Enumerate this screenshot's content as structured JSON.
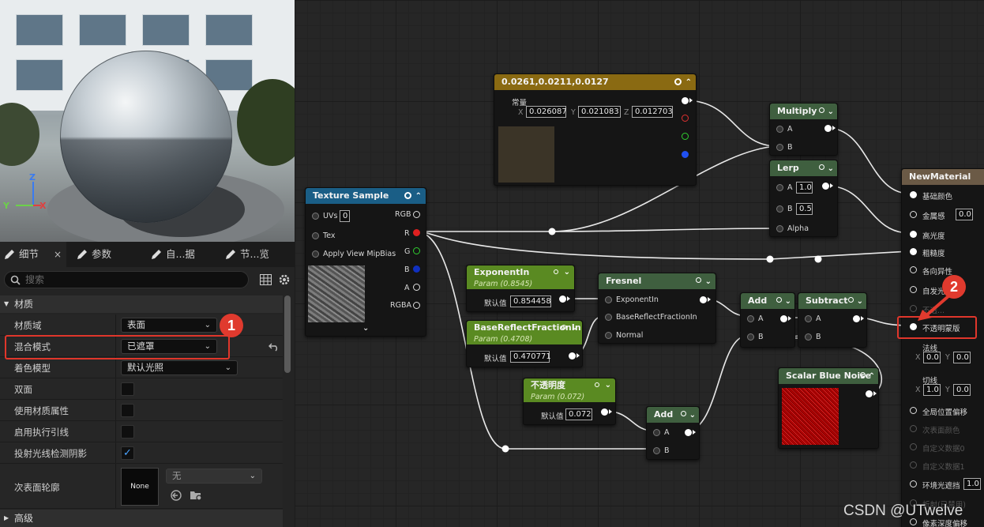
{
  "viewport": {
    "axis": {
      "z": "Z",
      "y": "Y",
      "x": "X"
    }
  },
  "tabs": [
    {
      "label": "细节",
      "close": "×"
    },
    {
      "label": "参数"
    },
    {
      "label": "自...据"
    },
    {
      "label": "节...览"
    }
  ],
  "search": {
    "placeholder": "搜索"
  },
  "details": {
    "section": "材质",
    "footer_section": "高级",
    "rows": {
      "domain": {
        "label": "材质域",
        "value": "表面"
      },
      "blend": {
        "label": "混合模式",
        "value": "已遮罩"
      },
      "shading": {
        "label": "着色模型",
        "value": "默认光照"
      },
      "two_sided": {
        "label": "双面"
      },
      "use_attr": {
        "label": "使用材质属性"
      },
      "exec_wires": {
        "label": "启用执行引线"
      },
      "rt_shadow": {
        "label": "投射光线检测阴影",
        "checked": "✓"
      },
      "subsurface": {
        "label": "次表面轮廓",
        "thumb": "None",
        "value": "无"
      }
    }
  },
  "nodes": {
    "constant": {
      "title": "0.0261,0.0211,0.0127",
      "label": "常量",
      "x_lbl": "X",
      "x": "0.026087",
      "y_lbl": "Y",
      "y": "0.021083",
      "z_lbl": "Z",
      "z": "0.012703"
    },
    "texture": {
      "title": "Texture Sample",
      "uvs": "UVs",
      "uvs_val": "0",
      "tex": "Tex",
      "mip": "Apply View MipBias",
      "rgb": "RGB",
      "r": "R",
      "g": "G",
      "b": "B",
      "a": "A",
      "rgba": "RGBA"
    },
    "exponent": {
      "title": "ExponentIn",
      "sub": "Param (0.8545)",
      "label": "默认值",
      "value": "0.854458"
    },
    "base_reflect": {
      "title": "BaseReflectFractionIn",
      "sub": "Param (0.4708)",
      "label": "默认值",
      "value": "0.470771"
    },
    "opacity_param": {
      "title": "不透明度",
      "sub": "Param (0.072)",
      "label": "默认值",
      "value": "0.072"
    },
    "fresnel": {
      "title": "Fresnel",
      "p1": "ExponentIn",
      "p2": "BaseReflectFractionIn",
      "p3": "Normal"
    },
    "multiply": {
      "title": "Multiply",
      "a": "A",
      "b": "B"
    },
    "lerp": {
      "title": "Lerp",
      "a": "A",
      "a_val": "1.0",
      "b": "B",
      "b_val": "0.5",
      "alpha": "Alpha"
    },
    "add1": {
      "title": "Add",
      "a": "A",
      "b": "B"
    },
    "add2": {
      "title": "Add",
      "a": "A",
      "b": "B"
    },
    "subtract": {
      "title": "Subtract",
      "a": "A",
      "b": "B"
    },
    "blue_noise": {
      "title": "Scalar Blue Noise"
    },
    "material": {
      "title": "NewMaterial",
      "base_color": "基础颜色",
      "metallic": "金属感",
      "metallic_val": "0.0",
      "specular": "高光度",
      "roughness": "粗糙度",
      "anisotropy": "各向异性",
      "emissive": "自发光",
      "opacity": "不透...",
      "opacity_mask": "不透明蒙版",
      "normal": "法线",
      "normal_x_lbl": "X",
      "normal_x": "0.0",
      "normal_y_lbl": "Y",
      "normal_y": "0.0",
      "tangent": "切线",
      "tangent_x_lbl": "X",
      "tangent_x": "1.0",
      "tangent_y_lbl": "Y",
      "tangent_y": "0.0",
      "wpo": "全局位置偏移",
      "subsurface_color": "次表面颜色",
      "custom0": "自定义数据0",
      "custom1": "自定义数据1",
      "ao": "环境光遮挡",
      "ao_val": "1.0",
      "refraction": "折射(已禁用)",
      "pixel_depth": "像素深度偏移"
    }
  },
  "badges": {
    "one": "1",
    "two": "2"
  },
  "watermark": "CSDN @UTwelve",
  "colors": {
    "texture_head": "#1a5e86",
    "constant_head": "#8a6a12",
    "param_head": "#5a8a22",
    "math_head": "#3f5f3f",
    "material_head": "#6b5a46",
    "highlight": "#e0362b"
  }
}
